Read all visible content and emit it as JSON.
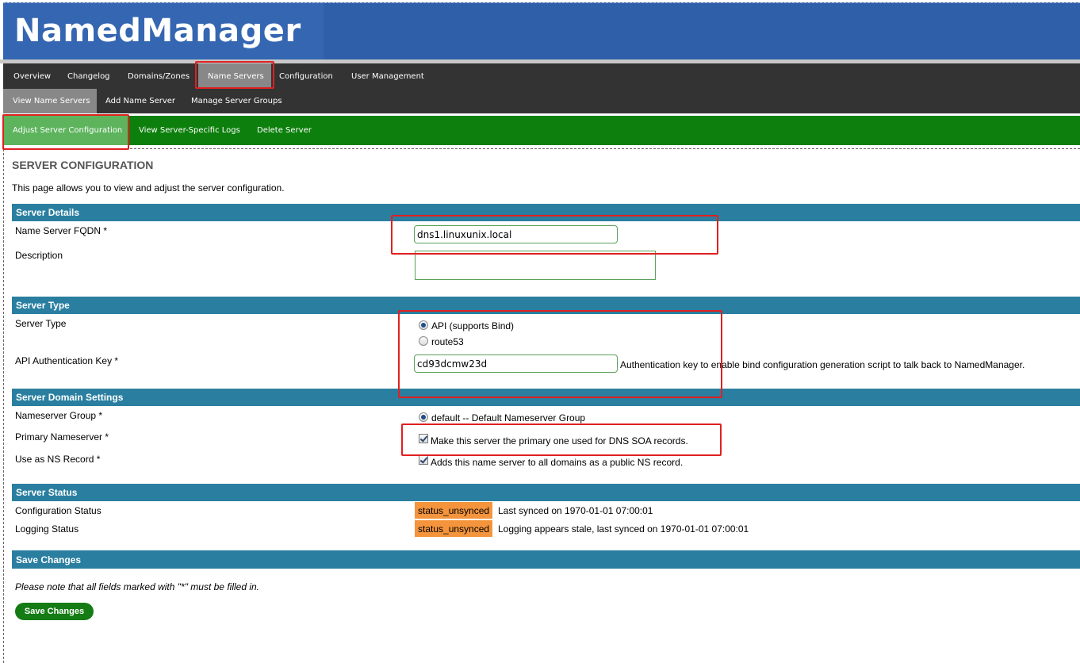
{
  "app": {
    "title": "NamedManager"
  },
  "nav": {
    "main": [
      {
        "label": "Overview"
      },
      {
        "label": "Changelog"
      },
      {
        "label": "Domains/Zones"
      },
      {
        "label": "Name Servers"
      },
      {
        "label": "Configuration"
      },
      {
        "label": "User Management"
      }
    ],
    "active_main": "Name Servers",
    "sub": [
      {
        "label": "View Name Servers"
      },
      {
        "label": "Add Name Server"
      },
      {
        "label": "Manage Server Groups"
      }
    ],
    "active_sub": "View Name Servers",
    "actions": [
      {
        "label": "Adjust Server Configuration"
      },
      {
        "label": "View Server-Specific Logs"
      },
      {
        "label": "Delete Server"
      }
    ],
    "active_action": "Adjust Server Configuration"
  },
  "page": {
    "title": "SERVER CONFIGURATION",
    "description": "This page allows you to view and adjust the server configuration."
  },
  "sections": {
    "server_details": {
      "heading": "Server Details",
      "fqdn_label": "Name Server FQDN *",
      "fqdn_value": "dns1.linuxunix.local",
      "description_label": "Description",
      "description_value": ""
    },
    "server_type": {
      "heading": "Server Type",
      "type_label": "Server Type",
      "options": [
        {
          "label": "API (supports Bind)",
          "selected": true
        },
        {
          "label": "route53",
          "selected": false
        }
      ],
      "api_key_label": "API Authentication Key *",
      "api_key_value": "cd93dcmw23d",
      "api_key_help": "Authentication key to enable bind configuration generation script to talk back to NamedManager."
    },
    "domain_settings": {
      "heading": "Server Domain Settings",
      "group_label": "Nameserver Group *",
      "group_option": "default -- Default Nameserver Group",
      "primary_label": "Primary Nameserver *",
      "primary_text": "Make this server the primary one used for DNS SOA records.",
      "primary_checked": true,
      "ns_label": "Use as NS Record *",
      "ns_text": "Adds this name server to all domains as a public NS record.",
      "ns_checked": true
    },
    "server_status": {
      "heading": "Server Status",
      "config_label": "Configuration Status",
      "config_badge": "status_unsynced",
      "config_text": "Last synced on 1970-01-01 07:00:01",
      "logging_label": "Logging Status",
      "logging_badge": "status_unsynced",
      "logging_text": "Logging appears stale, last synced on 1970-01-01 07:00:01"
    },
    "save": {
      "heading": "Save Changes",
      "note": "Please note that all fields marked with \"*\" must be filled in.",
      "button_label": "Save Changes"
    }
  },
  "colors": {
    "header": "#2f5fa8",
    "nav": "#333333",
    "action_bar": "#0d7f0d",
    "section_heading": "#2a7fa0",
    "status_badge": "#f4943c",
    "highlight": "#e02020"
  }
}
